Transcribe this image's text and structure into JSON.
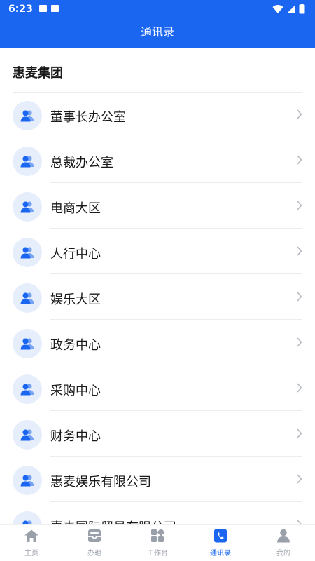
{
  "status_bar": {
    "time": "6:23"
  },
  "header": {
    "title": "通讯录"
  },
  "section": {
    "title": "惠麦集团"
  },
  "departments": [
    {
      "name": "董事长办公室"
    },
    {
      "name": "总裁办公室"
    },
    {
      "name": "电商大区"
    },
    {
      "name": "人行中心"
    },
    {
      "name": "娱乐大区"
    },
    {
      "name": "政务中心"
    },
    {
      "name": "采购中心"
    },
    {
      "name": "财务中心"
    },
    {
      "name": "惠麦娱乐有限公司"
    },
    {
      "name": "惠麦国际贸易有限公司"
    }
  ],
  "tabbar": {
    "tabs": [
      {
        "label": "主页",
        "icon": "home-icon"
      },
      {
        "label": "办理",
        "icon": "inbox-icon"
      },
      {
        "label": "工作台",
        "icon": "grid-icon"
      },
      {
        "label": "通讯录",
        "icon": "phone-book-icon"
      },
      {
        "label": "我的",
        "icon": "user-icon"
      }
    ],
    "active_index": 3
  },
  "colors": {
    "primary": "#1a66f0",
    "avatar_bg": "#e6eefc",
    "inactive": "#9aa0aa"
  }
}
